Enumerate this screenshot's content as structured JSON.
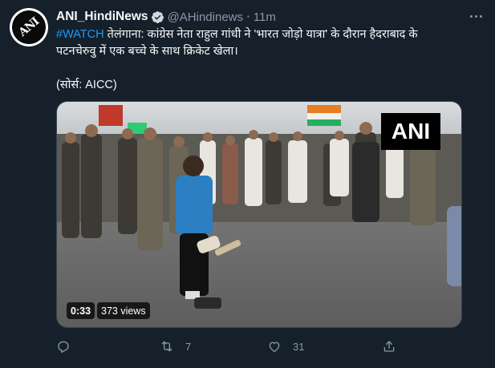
{
  "tweet": {
    "author_name": "ANI_HindiNews",
    "author_handle": "@AHindinews",
    "separator": "·",
    "time": "11m",
    "avatar_text": "ANI",
    "hashtag": "#WATCH",
    "body_line1": " तेलंगाना: कांग्रेस नेता राहुल गांधी ने 'भारत जोड़ो यात्रा' के दौरान हैदराबाद के",
    "body_line2": "पटनचेरुवु में एक बच्चे के साथ क्रिकेट खेला।",
    "source": "(सोर्स: AICC)"
  },
  "media": {
    "watermark": "ANI",
    "duration": "0:33",
    "views": "373 views"
  },
  "actions": {
    "reply_count": "",
    "retweet_count": "7",
    "like_count": "31"
  },
  "colors": {
    "background": "#15202b",
    "accent": "#1d9bf0",
    "secondary_text": "#8b98a5"
  },
  "icons": [
    "verified-badge-icon",
    "more-options-icon",
    "reply-icon",
    "retweet-icon",
    "like-icon",
    "share-icon"
  ]
}
